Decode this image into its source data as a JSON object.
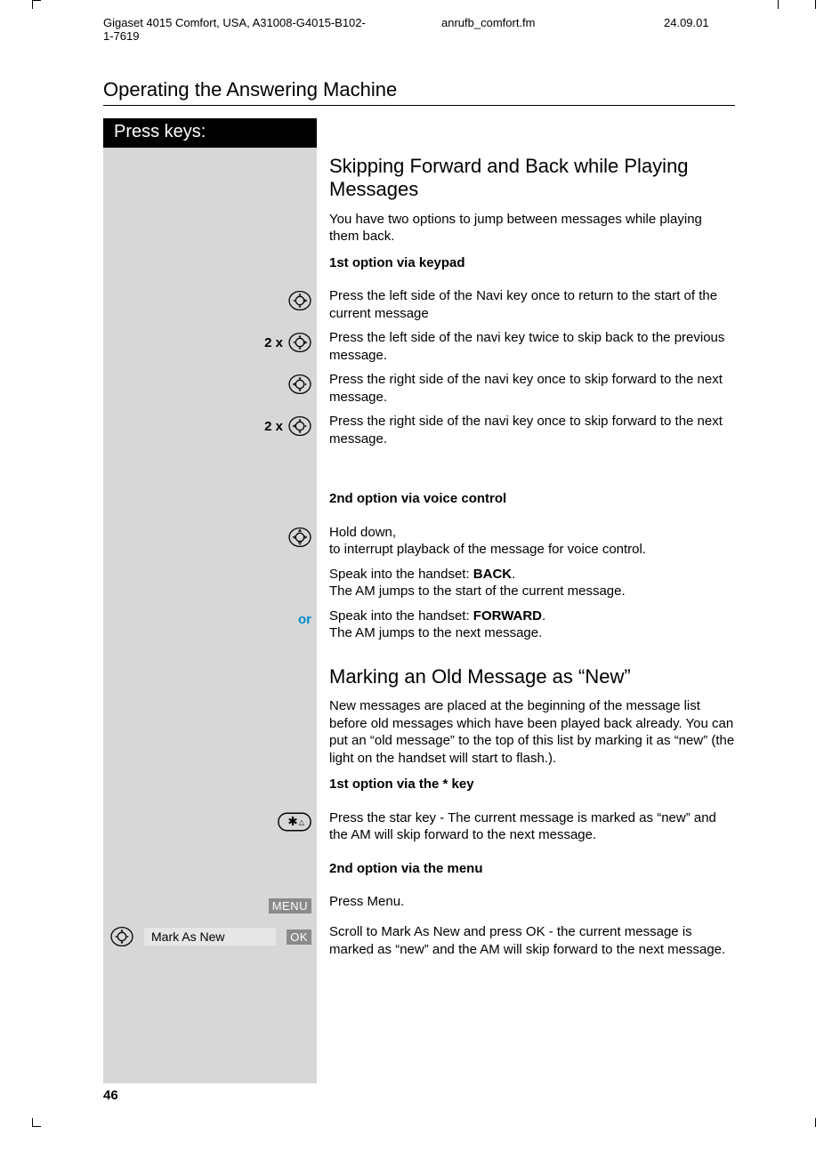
{
  "header": {
    "product": "Gigaset 4015 Comfort, USA, A31008-G4015-B102-1-7619",
    "file": "anrufb_comfort.fm",
    "date": "24.09.01"
  },
  "section_title": "Operating the Answering Machine",
  "press_keys_label": "Press keys:",
  "skip": {
    "heading": "Skipping Forward and Back while Playing Messages",
    "intro": "You have two options to jump between messages while playing them back.",
    "opt1_head": "1st option via keypad",
    "steps": [
      {
        "prefix": "",
        "text": "Press the left side of the Navi key once to return to the start of the current message"
      },
      {
        "prefix": "2 x",
        "text": "Press the left side of the navi key twice to skip back to the previous message."
      },
      {
        "prefix": "",
        "text": "Press the right side of the navi key once to skip forward to the next message."
      },
      {
        "prefix": "2 x",
        "text": "Press the right side of the navi key once to skip forward to the next message."
      }
    ],
    "opt2_head": "2nd option via voice control",
    "hold_down": "Hold down,",
    "hold_down2": "to interrupt playback of the message for voice control.",
    "speak_back_pre": "Speak into the handset: ",
    "speak_back_word": "BACK",
    "speak_back_post": ".",
    "speak_back_result": "The AM jumps to the start of the current message.",
    "or": "or",
    "speak_fwd_pre": "Speak into the handset: ",
    "speak_fwd_word": "FORWARD",
    "speak_fwd_post": ".",
    "speak_fwd_result": "The AM jumps to the next message."
  },
  "mark": {
    "heading": "Marking an Old Message as “New”",
    "intro": "New messages are placed at the beginning of the message list before old messages which have been played back already.  You can put an “old message” to the top of this list by marking it as “new” (the light on the handset will start to flash.).",
    "opt1_head": "1st option via the * key",
    "star_text": "Press the star key - The current message is marked as “new” and the AM will skip forward to the next message.",
    "opt2_head": "2nd option via the menu",
    "menu_label": "MENU",
    "menu_text": "Press Menu.",
    "mark_as_new": "Mark As New",
    "ok_label": "OK",
    "ok_text": "Scroll to Mark As New and press OK - the current message is marked as “new” and the AM will skip forward to the next message."
  },
  "page_number": "46"
}
